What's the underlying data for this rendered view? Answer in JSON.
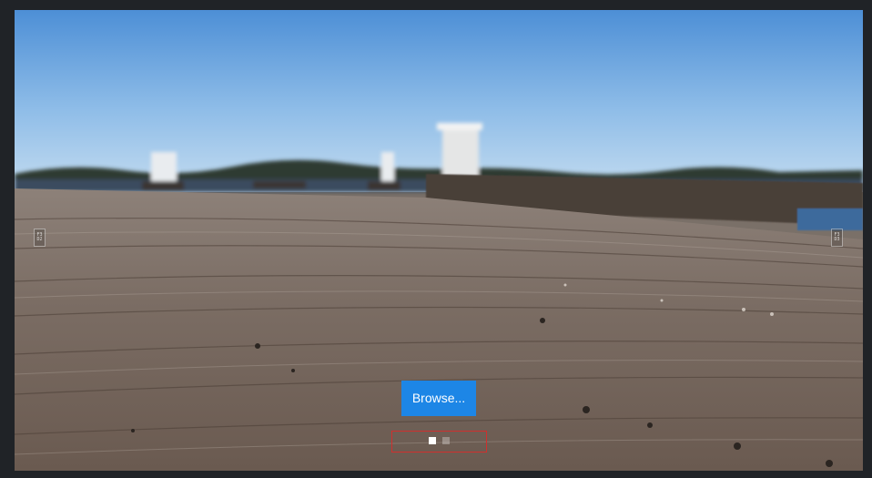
{
  "viewer": {
    "image_alt": "Weathered wooden boardwalk pier with blurred harbor and blue sky",
    "prev_icon_glyph": "F3\nD2",
    "next_icon_glyph": "F3\nD3",
    "browse_label": "Browse...",
    "slides": {
      "count": 2,
      "active": 0
    }
  },
  "colors": {
    "background": "#202327",
    "accent": "#1d86e6",
    "dot_frame": "#d0302e"
  }
}
